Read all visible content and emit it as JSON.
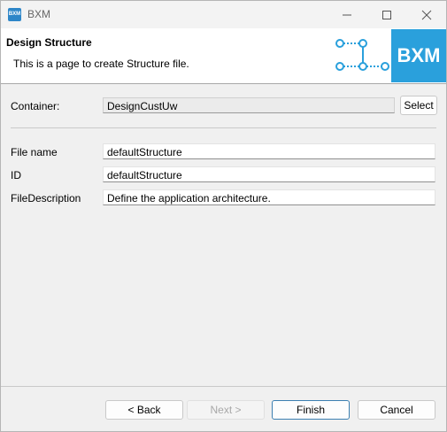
{
  "window": {
    "title": "BXM",
    "icon_text": "BXM",
    "icons": [
      "minimize-icon",
      "maximize-icon",
      "close-icon"
    ]
  },
  "banner": {
    "title": "Design Structure",
    "description": "This is a page to create Structure file.",
    "logo_text": "BXM",
    "accent": "#2aa0dc"
  },
  "form": {
    "container": {
      "label": "Container:",
      "value": "DesignCustUw",
      "button": "Select"
    },
    "file_name": {
      "label": "File name",
      "value": "defaultStructure"
    },
    "id": {
      "label": "ID",
      "value": "defaultStructure"
    },
    "file_description": {
      "label": "FileDescription",
      "value": "Define the application architecture."
    }
  },
  "buttons": {
    "back": "< Back",
    "next": "Next >",
    "finish": "Finish",
    "cancel": "Cancel"
  }
}
